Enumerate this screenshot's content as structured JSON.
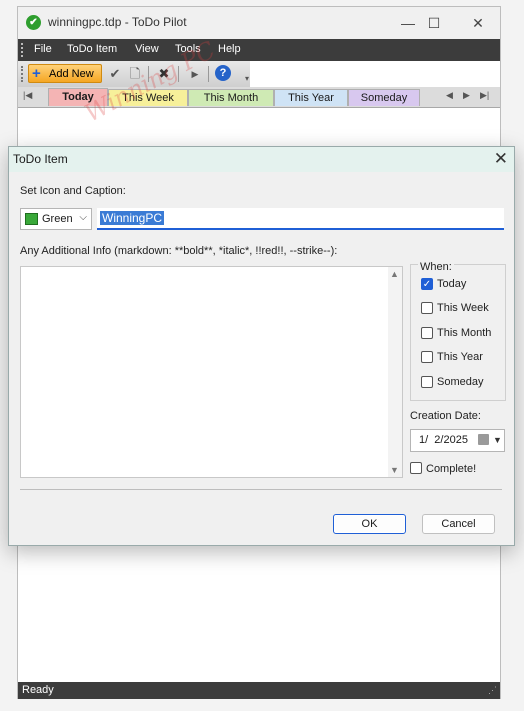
{
  "window": {
    "title": "winningpc.tdp - ToDo Pilot",
    "app_icon_glyph": "✔",
    "minimize_glyph": "—",
    "maximize_glyph": "☐",
    "close_glyph": "✕"
  },
  "menubar": {
    "items": [
      "File",
      "ToDo Item",
      "View",
      "Tools",
      "Help"
    ]
  },
  "toolbar": {
    "add_new_label": "Add New",
    "icons": [
      "plus-icon",
      "check-icon",
      "document-icon",
      "delete-icon",
      "arrow-right-icon",
      "help-icon"
    ]
  },
  "tabs": [
    {
      "label": "Today",
      "color": "#f4b4b4",
      "active": true
    },
    {
      "label": "This Week",
      "color": "#f7f09a",
      "active": false
    },
    {
      "label": "This Month",
      "color": "#cfeab4",
      "active": false
    },
    {
      "label": "This Year",
      "color": "#cfe3f5",
      "active": false
    },
    {
      "label": "Someday",
      "color": "#d8c8ef",
      "active": false
    }
  ],
  "watermark_text": "Winning PC",
  "dialog": {
    "title": "ToDo Item",
    "close_glyph": "✕",
    "icon_caption_label": "Set Icon and Caption:",
    "icon_select_value": "Green",
    "caption_value": "WinningPC",
    "info_label": "Any Additional Info (markdown: **bold**, *italic*, !!red!!, --strike--):",
    "info_value": "",
    "when_label": "When:",
    "when_options": [
      {
        "label": "Today",
        "checked": true
      },
      {
        "label": "This Week",
        "checked": false
      },
      {
        "label": "This Month",
        "checked": false
      },
      {
        "label": "This Year",
        "checked": false
      },
      {
        "label": "Someday",
        "checked": false
      }
    ],
    "creation_date_label": "Creation Date:",
    "creation_date_value": "1/  2/2025",
    "complete_label": "Complete!",
    "complete_checked": false,
    "ok_label": "OK",
    "cancel_label": "Cancel"
  },
  "status": {
    "text": "Ready"
  },
  "colors": {
    "accent": "#1f5fd6",
    "menubar": "#3c3c3c",
    "dialog_title": "#e4f2ee",
    "add_new": "#f5a623"
  }
}
